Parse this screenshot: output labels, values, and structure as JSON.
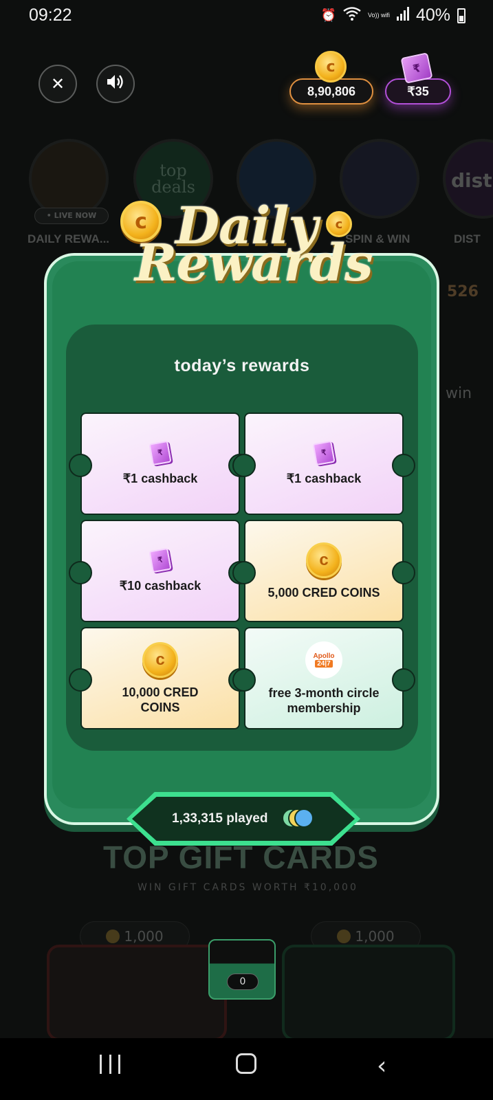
{
  "status_bar": {
    "time": "09:22",
    "signal_text": "Vo)) wifi",
    "battery": "40%"
  },
  "header": {
    "coins_balance": "8,90,806",
    "cash_balance": "₹35",
    "coin_symbol": "c",
    "cash_symbol": "₹"
  },
  "background": {
    "live_now": "• LIVE NOW",
    "tile_labels": [
      "DAILY REWA...",
      "SPIN & WIN",
      "DIST"
    ],
    "tile_logo_top_deals": "top deals",
    "tile_logo_dist": "dist",
    "side_count": "526",
    "side_text_right": "win",
    "section_title": "TOP GIFT CARDS",
    "section_subtitle": "WIN GIFT CARDS WORTH ₹10,000",
    "card_left_price": "1,000",
    "card_right_price": "1,000"
  },
  "modal": {
    "logo_line1": "Daily",
    "logo_line2": "Rewards",
    "panel_title": "today’s rewards",
    "rewards": [
      {
        "label": "₹1 cashback",
        "icon": "cashback-icon",
        "style": "purple"
      },
      {
        "label": "₹1 cashback",
        "icon": "cashback-icon",
        "style": "purple"
      },
      {
        "label": "₹10 cashback",
        "icon": "cashback-icon",
        "style": "purple"
      },
      {
        "label": "5,000 CRED COINS",
        "icon": "cred-coin-icon",
        "style": "gold"
      },
      {
        "label": "10,000 CRED COINS",
        "icon": "cred-coin-icon",
        "style": "gold"
      },
      {
        "label": "free 3-month circle membership",
        "icon": "apollo-247-icon",
        "style": "mint"
      }
    ],
    "apollo_text": "Apollo",
    "apollo_badge": "24|7",
    "played": "1,33,315 played"
  },
  "counter": {
    "value": "0"
  },
  "colors": {
    "modal_green": "#2a8a5c",
    "panel_green": "#1a5c3b",
    "accent_mint": "#3de08f",
    "coin_gold": "#f3b21c",
    "cash_purple": "#b250d8"
  }
}
